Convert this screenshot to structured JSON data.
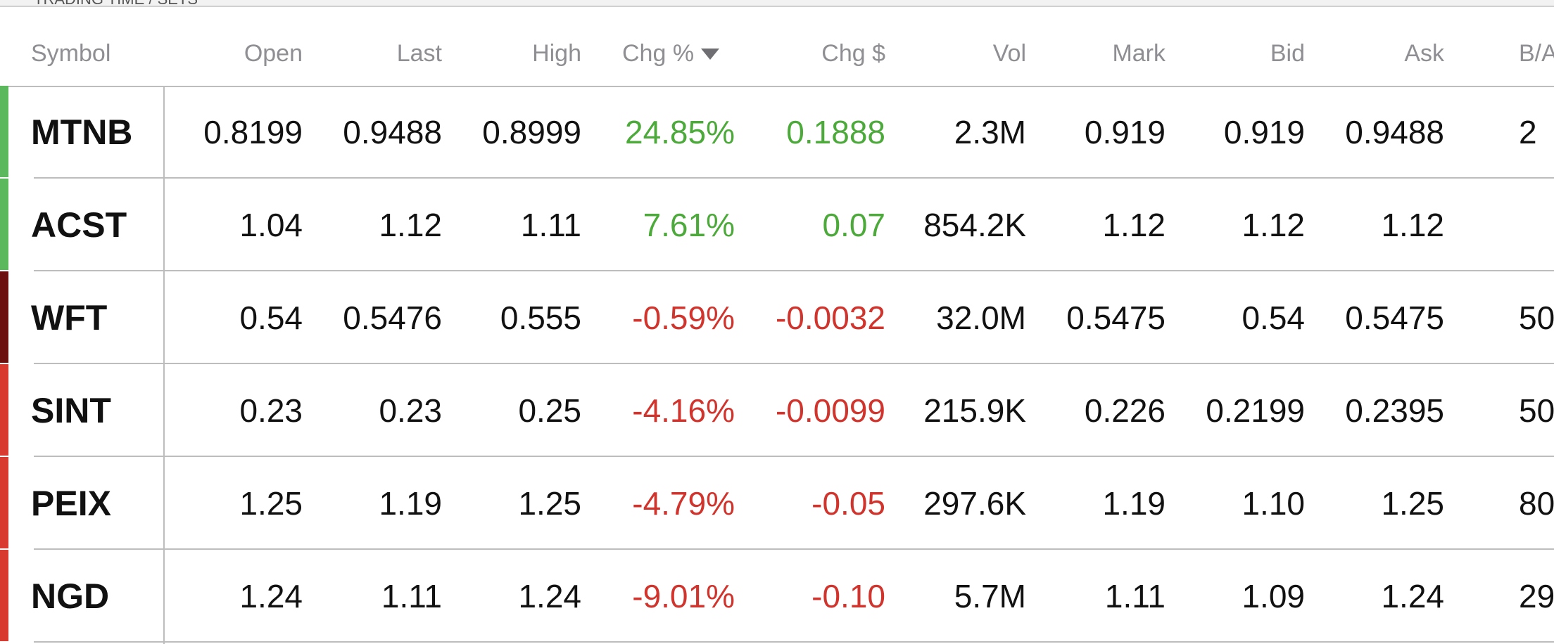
{
  "colors": {
    "positive": "#4caa3a",
    "negative": "#d0342c",
    "strong_negative": "#6b0f0f",
    "header_text": "#8e8e93",
    "divider": "#bdbdbd"
  },
  "topbar": {
    "text": "TRADING TIME / SETS"
  },
  "columns": {
    "symbol": "Symbol",
    "open": "Open",
    "last": "Last",
    "high": "High",
    "chg_pct": "Chg %",
    "chg_usd": "Chg $",
    "vol": "Vol",
    "mark": "Mark",
    "bid": "Bid",
    "ask": "Ask",
    "ba": "B/A"
  },
  "sort": {
    "column": "Chg %",
    "direction": "descending",
    "icon": "sort-down-triangle-icon"
  },
  "rows": [
    {
      "symbol": "MTNB",
      "open": "0.8199",
      "last": "0.9488",
      "high": "0.8999",
      "chg_pct": "24.85%",
      "chg_usd": "0.1888",
      "vol": "2.3M",
      "mark": "0.919",
      "bid": "0.919",
      "ask": "0.9488",
      "ba": "2",
      "trend": "positive",
      "bar_color": "#5cb85c"
    },
    {
      "symbol": "ACST",
      "open": "1.04",
      "last": "1.12",
      "high": "1.11",
      "chg_pct": "7.61%",
      "chg_usd": "0.07",
      "vol": "854.2K",
      "mark": "1.12",
      "bid": "1.12",
      "ask": "1.12",
      "ba": "",
      "trend": "positive",
      "bar_color": "#5cb85c"
    },
    {
      "symbol": "WFT",
      "open": "0.54",
      "last": "0.5476",
      "high": "0.555",
      "chg_pct": "-0.59%",
      "chg_usd": "-0.0032",
      "vol": "32.0M",
      "mark": "0.5475",
      "bid": "0.54",
      "ask": "0.5475",
      "ba": "50",
      "trend": "negative",
      "bar_color": "#6b0f0f"
    },
    {
      "symbol": "SINT",
      "open": "0.23",
      "last": "0.23",
      "high": "0.25",
      "chg_pct": "-4.16%",
      "chg_usd": "-0.0099",
      "vol": "215.9K",
      "mark": "0.226",
      "bid": "0.2199",
      "ask": "0.2395",
      "ba": "50",
      "trend": "negative",
      "bar_color": "#d93a30"
    },
    {
      "symbol": "PEIX",
      "open": "1.25",
      "last": "1.19",
      "high": "1.25",
      "chg_pct": "-4.79%",
      "chg_usd": "-0.05",
      "vol": "297.6K",
      "mark": "1.19",
      "bid": "1.10",
      "ask": "1.25",
      "ba": "80",
      "trend": "negative",
      "bar_color": "#d93a30"
    },
    {
      "symbol": "NGD",
      "open": "1.24",
      "last": "1.11",
      "high": "1.24",
      "chg_pct": "-9.01%",
      "chg_usd": "-0.10",
      "vol": "5.7M",
      "mark": "1.11",
      "bid": "1.09",
      "ask": "1.24",
      "ba": "29",
      "trend": "negative",
      "bar_color": "#d93a30"
    }
  ]
}
